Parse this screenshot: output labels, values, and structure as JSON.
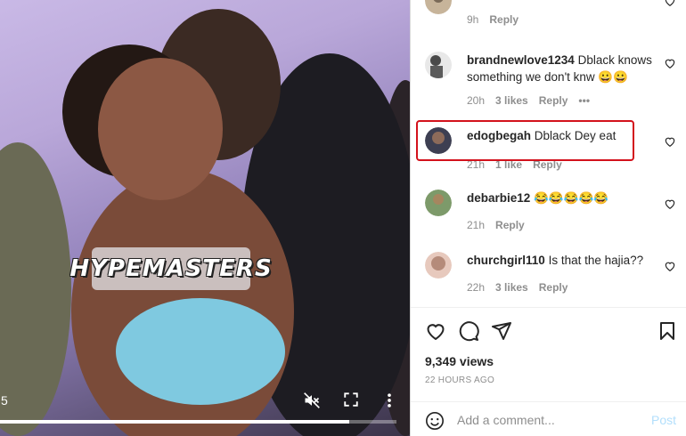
{
  "video": {
    "watermark": "HYPEMASTERS",
    "time": "5",
    "progress": 0.88
  },
  "comments": [
    {
      "username": "",
      "text": "",
      "time": "9h",
      "likes": "",
      "reply": "Reply",
      "avatar_color": "#c7b49a"
    },
    {
      "username": "brandnewlove1234",
      "text": "Dblack knows something we don't knw 😀😀",
      "time": "20h",
      "likes": "3 likes",
      "reply": "Reply",
      "more": "•••",
      "avatar_color": "#5b5b5b"
    },
    {
      "username": "edogbegah",
      "text": "Dblack Dey eat",
      "time": "21h",
      "likes": "1 like",
      "reply": "Reply",
      "avatar_color": "#3d3f52"
    },
    {
      "username": "debarbie12",
      "text": "😂😂😂😂😂",
      "time": "21h",
      "likes": "",
      "reply": "Reply",
      "avatar_color": "#7d9a6a"
    },
    {
      "username": "churchgirl110",
      "text": "Is that the hajia??",
      "time": "22h",
      "likes": "3 likes",
      "reply": "Reply",
      "avatar_color": "#b58b7a"
    }
  ],
  "stats": {
    "views": "9,349 views",
    "posted": "22 HOURS AGO"
  },
  "add_comment": {
    "placeholder": "Add a comment...",
    "post_label": "Post"
  },
  "icons": [
    "heart-icon",
    "comment-icon",
    "share-icon",
    "bookmark-icon",
    "mute-icon",
    "fullscreen-icon",
    "more-icon",
    "emoji-icon"
  ],
  "colors": {
    "highlight": "#d3121c",
    "post_disabled": "#b2dffc",
    "meta_grey": "#8e8e8e"
  }
}
